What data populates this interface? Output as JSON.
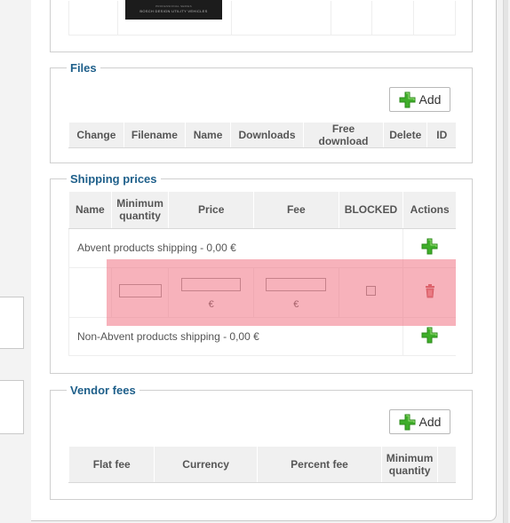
{
  "top_image": {
    "strapline": "PROFESSIONAL SERIES",
    "text": "BOSCH DESIGN UTILITY VEHICLES"
  },
  "files": {
    "legend": "Files",
    "add_label": "Add",
    "columns": [
      "Change",
      "Filename",
      "Name",
      "Downloads",
      "Free download",
      "Delete",
      "ID"
    ]
  },
  "shipping": {
    "legend": "Shipping prices",
    "columns": {
      "name": "Name",
      "min_qty": "Minimum quantity",
      "price": "Price",
      "fee": "Fee",
      "blocked": "BLOCKED",
      "actions": "Actions"
    },
    "row_abvent": "Abvent products shipping - 0,00 €",
    "row_non_abvent": "Non-Abvent products shipping - 0,00 €",
    "currency_symbol": "€",
    "blocked_checked": false
  },
  "vendor_fees": {
    "legend": "Vendor fees",
    "add_label": "Add",
    "columns": [
      "Flat fee",
      "Currency",
      "Percent fee",
      "Minimum quantity"
    ]
  },
  "colors": {
    "legend_text": "#1e5f8a",
    "plus_green": "#3fae2a",
    "highlight": "#f06c7c"
  },
  "icons": {
    "add": "green-plus-icon",
    "delete": "trash-icon"
  }
}
